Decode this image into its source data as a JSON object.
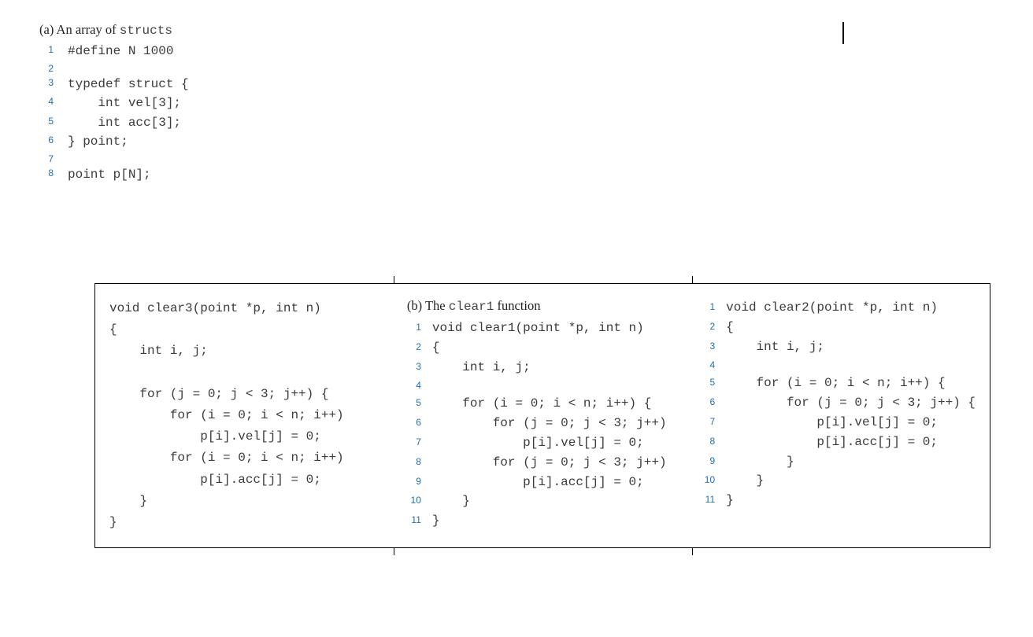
{
  "blockA": {
    "caption_prefix": "(a) An array of ",
    "caption_mono": "structs",
    "lines": [
      "#define N 1000",
      "",
      "typedef struct {",
      "    int vel[3];",
      "    int acc[3];",
      "} point;",
      "",
      "point p[N];"
    ]
  },
  "colLeft": {
    "lines": [
      "void clear3(point *p, int n)",
      "{",
      "    int i, j;",
      "",
      "    for (j = 0; j < 3; j++) {",
      "        for (i = 0; i < n; i++)",
      "            p[i].vel[j] = 0;",
      "        for (i = 0; i < n; i++)",
      "            p[i].acc[j] = 0;",
      "    }",
      "}"
    ]
  },
  "colMid": {
    "caption_prefix": "(b) The ",
    "caption_mono": "clear1",
    "caption_suffix": " function",
    "lines": [
      "void clear1(point *p, int n)",
      "{",
      "    int i, j;",
      "",
      "    for (i = 0; i < n; i++) {",
      "        for (j = 0; j < 3; j++)",
      "            p[i].vel[j] = 0;",
      "        for (j = 0; j < 3; j++)",
      "            p[i].acc[j] = 0;",
      "    }",
      "}"
    ]
  },
  "colRight": {
    "lines": [
      "void clear2(point *p, int n)",
      "{",
      "    int i, j;",
      "",
      "    for (i = 0; i < n; i++) {",
      "        for (j = 0; j < 3; j++) {",
      "            p[i].vel[j] = 0;",
      "            p[i].acc[j] = 0;",
      "        }",
      "    }",
      "}"
    ]
  }
}
